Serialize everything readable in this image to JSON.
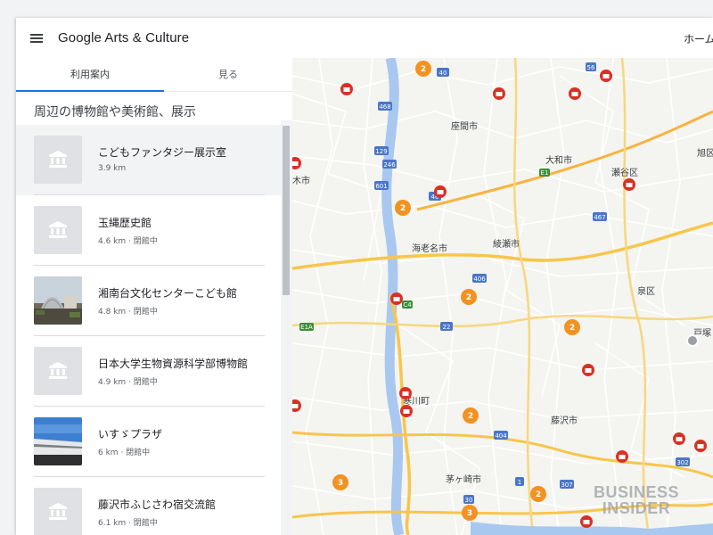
{
  "header": {
    "brand": "Google Arts & Culture",
    "home_label": "ホーム"
  },
  "tabs": [
    {
      "label": "利用案内",
      "active": true
    },
    {
      "label": "見る",
      "active": false
    }
  ],
  "section_title": "周辺の博物館や美術館、展示",
  "places": [
    {
      "name": "こどもファンタジー展示室",
      "meta": "3.9 km",
      "thumb": "museum-icon"
    },
    {
      "name": "玉縄歴史館",
      "meta": "4.6 km · 閉館中",
      "thumb": "museum-icon"
    },
    {
      "name": "湘南台文化センターこども館",
      "meta": "4.8 km · 閉館中",
      "thumb": "photo-dome"
    },
    {
      "name": "日本大学生物資源科学部博物館",
      "meta": "4.9 km · 閉館中",
      "thumb": "museum-icon"
    },
    {
      "name": "いすゞプラザ",
      "meta": "6 km · 閉館中",
      "thumb": "photo-building"
    },
    {
      "name": "藤沢市ふじさわ宿交流館",
      "meta": "6.1 km · 閉館中",
      "thumb": "museum-icon"
    }
  ],
  "map": {
    "place_labels": [
      "座間市",
      "大和市",
      "瀬谷区",
      "旭区",
      "木市",
      "海老名市",
      "綾瀬市",
      "泉区",
      "戸塚",
      "寒川町",
      "藤沢市",
      "茅ヶ崎市"
    ],
    "clusters": [
      "2",
      "2",
      "2",
      "2",
      "2",
      "3",
      "3",
      "2"
    ],
    "road_shields": [
      "468",
      "129",
      "40",
      "601",
      "46",
      "246",
      "22",
      "E1",
      "56",
      "C4",
      "406",
      "E1A",
      "467",
      "404",
      "307",
      "302",
      "30",
      "1"
    ]
  },
  "watermark": {
    "line1": "BUSINESS",
    "line2": "INSIDER"
  },
  "colors": {
    "accent": "#1a73e8",
    "cluster": "#f29222",
    "poi": "#d93025",
    "river": "#a9c8f0"
  }
}
